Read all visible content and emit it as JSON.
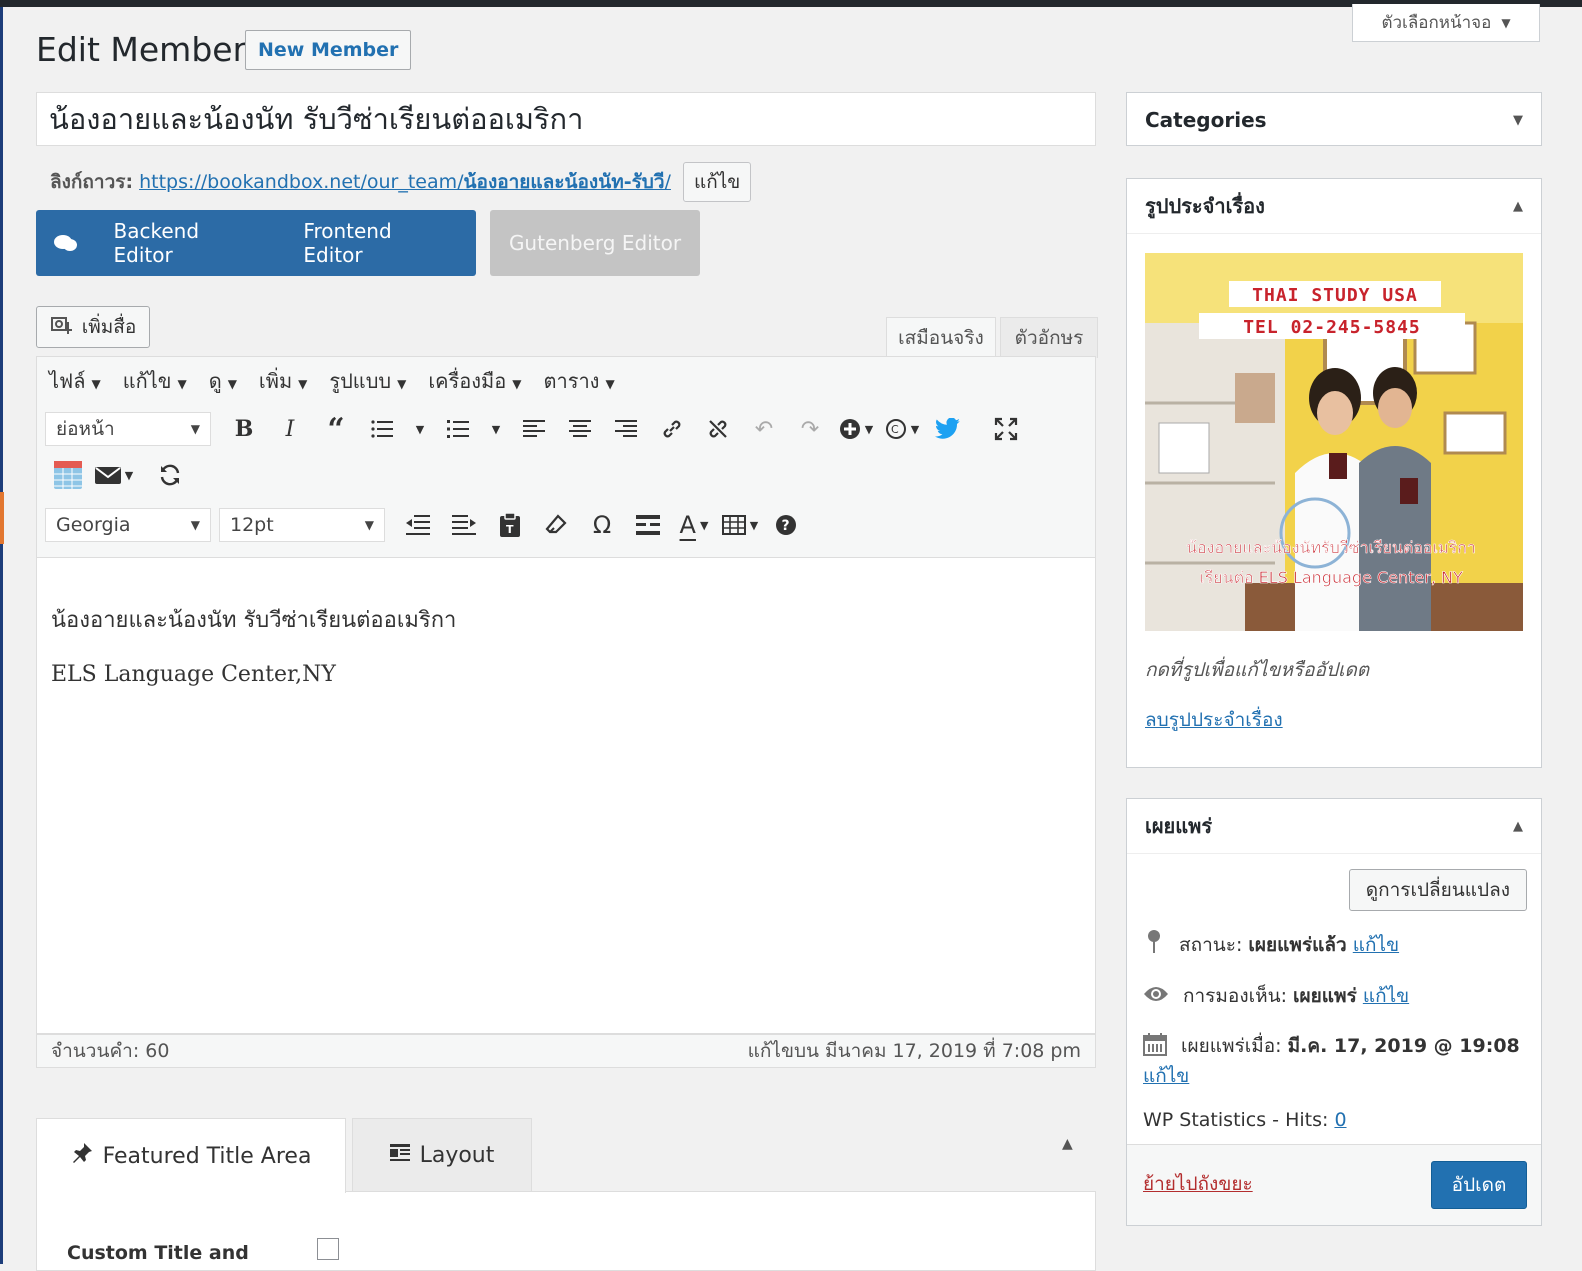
{
  "screen_options": "ตัวเลือกหน้าจอ",
  "page": {
    "title": "Edit Member",
    "new_button": "New Member"
  },
  "post_title": "น้องอายและน้องนัท รับวีซ่าเรียนต่ออเมริกา",
  "permalink": {
    "label": "ลิงก์ถาวร:",
    "url_base": "https://bookandbox.net/our_team/",
    "url_slug": "น้องอายและน้องนัท-รับวี",
    "url_end": "/",
    "edit": "แก้ไข"
  },
  "builder": {
    "backend": "Backend Editor",
    "frontend": "Frontend Editor",
    "gutenberg": "Gutenberg Editor"
  },
  "editor": {
    "add_media": "เพิ่มสื่อ",
    "tab_visual": "เสมือนจริง",
    "tab_text": "ตัวอักษร",
    "menu": [
      "ไฟล์",
      "แก้ไข",
      "ดู",
      "เพิ่ม",
      "รูปแบบ",
      "เครื่องมือ",
      "ตาราง"
    ],
    "format_select": "ย่อหน้า",
    "font_family": "Georgia",
    "font_size": "12pt",
    "content_line1": "น้องอายและน้องนัท รับวีซ่าเรียนต่ออเมริกา",
    "content_line2": "ELS Language Center,NY",
    "word_count": "จำนวนคำ: 60",
    "last_edited": "แก้ไขบน มีนาคม 17, 2019 ที่ 7:08 pm"
  },
  "meta_box": {
    "tab_featured": "Featured Title Area",
    "tab_layout": "Layout",
    "custom_title_label": "Custom Title and"
  },
  "sidebar": {
    "categories": "Categories",
    "featured": {
      "title": "รูปประจำเรื่อง",
      "banner_line1": "THAI STUDY USA",
      "banner_line2": "TEL 02-245-5845",
      "caption_line1": "น้องอายและน้องนัทรับวีซ่าเรียนต่ออเมริกา",
      "caption_line2": "เรียนต่อ ELS Language Center, NY",
      "hint": "กดที่รูปเพื่อแก้ไขหรืออัปเดต",
      "remove": "ลบรูปประจำเรื่อง"
    },
    "publish": {
      "title": "เผยแพร่",
      "preview": "ดูการเปลี่ยนแปลง",
      "status_label": "สถานะ:",
      "status_value": "เผยแพร่แล้ว",
      "visibility_label": "การมองเห็น:",
      "visibility_value": "เผยแพร่",
      "published_label": "เผยแพร่เมื่อ:",
      "published_value": "มี.ค. 17, 2019 @ 19:08",
      "edit": "แก้ไข",
      "stats_label": "WP Statistics - Hits:",
      "stats_value": "0",
      "trash": "ย้ายไปถังขยะ",
      "update": "อัปเดต"
    }
  }
}
